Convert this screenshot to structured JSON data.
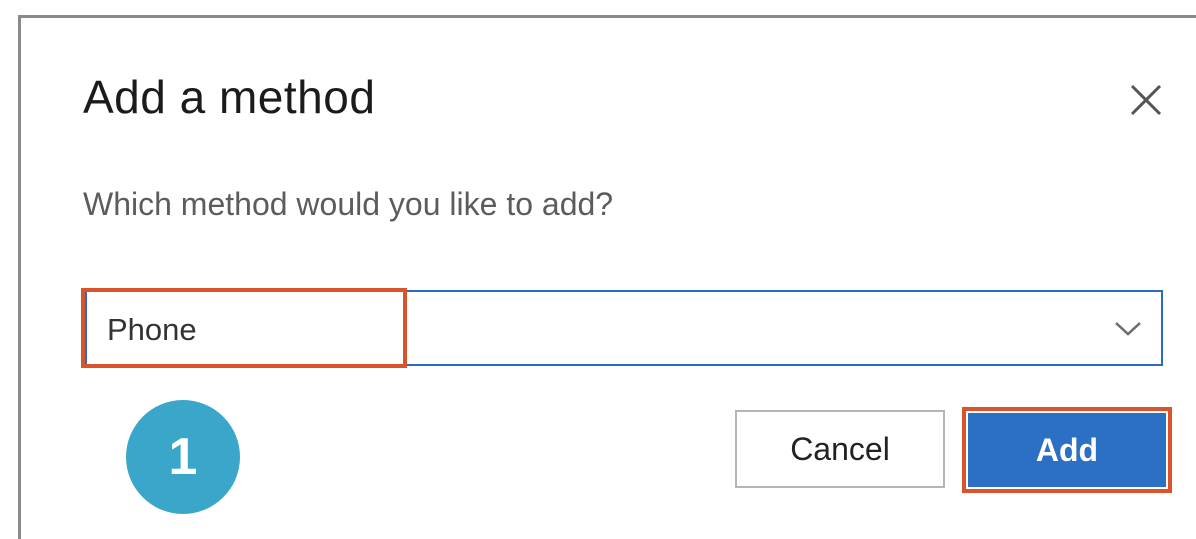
{
  "dialog": {
    "title": "Add a method",
    "prompt": "Which method would you like to add?",
    "close_icon": "close-icon"
  },
  "method_select": {
    "selected_value": "Phone",
    "chevron_icon": "chevron-down-icon"
  },
  "annotation": {
    "step_number": "1",
    "highlight_color": "#d9542b",
    "badge_color": "#3aa6c9"
  },
  "actions": {
    "cancel_label": "Cancel",
    "add_label": "Add",
    "primary_color": "#2b70c4"
  }
}
